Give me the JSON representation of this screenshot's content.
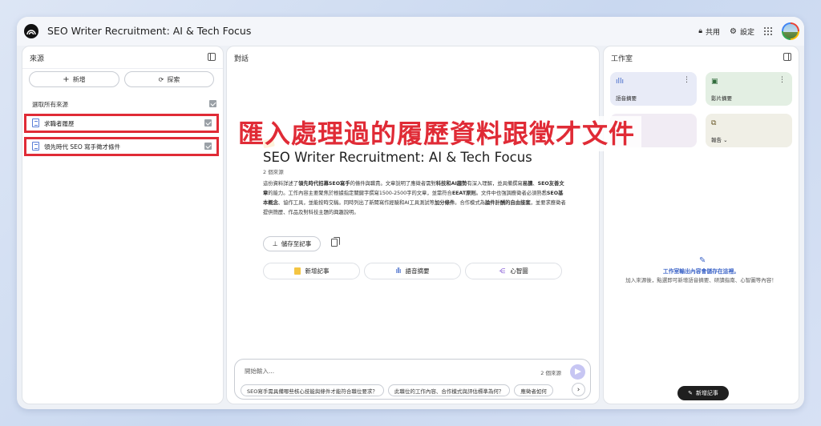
{
  "app": {
    "title": "SEO Writer Recruitment: AI & Tech Focus",
    "share_label": "共用",
    "settings_label": "設定"
  },
  "sources": {
    "title": "來源",
    "add_label": "新增",
    "explore_label": "探索",
    "select_all": "選取所有來源",
    "items": [
      {
        "label": "求職者履歷"
      },
      {
        "label": "領先時代 SEO 寫手徵才條件"
      }
    ]
  },
  "chat": {
    "title": "對話",
    "notebook_title": "SEO Writer Recruitment: AI & Tech Focus",
    "source_count": "2 個來源",
    "summary": {
      "s1": "這份資料詳述了",
      "b1": "領先時代招募SEO寫手",
      "s2": "的條件與職責。文章說明了應徵者需對",
      "b2": "科技和AI趨勢",
      "s3": "有深入理解，並具備撰寫",
      "b3": "易讀",
      "s4": "、",
      "b4": "SEO友善文章",
      "s5": "的能力。工作內容主要聚焦於根據指定關鍵字撰寫1500-2500字的文章，並需符合",
      "b5": "EEAT原則",
      "s6": "。文件中也強調應徵者必須熟悉",
      "b6": "SEO基本概念",
      "s7": "、協作工具，並能按時交稿。同時列出了新聞寫作經驗和AI工具測試等",
      "b7": "加分條件",
      "s8": "。合作模式為",
      "b8": "論件計酬的自由接案",
      "s9": "，並要求應徵者提供簡歷、作品及對科技主題的興趣說明。"
    },
    "save_note_label": "儲存至記事",
    "actions": [
      {
        "label": "新增記事"
      },
      {
        "label": "語音摘要"
      },
      {
        "label": "心智圖"
      }
    ],
    "composer_placeholder": "開始輸入...",
    "composer_count": "2 個來源",
    "suggestions": [
      "SEO寫手需具備哪些核心技能與條件才能符合職位要求？",
      "此職位的工作內容、合作模式與評估標準為何？",
      "應徵者如何"
    ]
  },
  "studio": {
    "title": "工作室",
    "tiles": [
      {
        "label": "語音摘要",
        "icon": "audio-wave-icon",
        "color": "#e8ebf7"
      },
      {
        "label": "影片摘要",
        "icon": "video-icon",
        "color": "#e3efe3"
      },
      {
        "label": "",
        "icon": "mindmap-icon",
        "color": "#f1ecf4"
      },
      {
        "label": "報告",
        "icon": "report-icon",
        "color": "#f0efe6"
      }
    ],
    "empty_title": "工作室輸出內容會儲存在這裡。",
    "empty_desc": "加入來源後，點選即可新增語音摘要、研讀指南、心智圖等內容！",
    "add_note_label": "新增記事"
  },
  "overlay": {
    "caption": "匯入處理過的履歷資料跟徵才文件"
  },
  "colors": {
    "highlight_red": "#e02b36",
    "accent_blue": "#3b63c7"
  }
}
